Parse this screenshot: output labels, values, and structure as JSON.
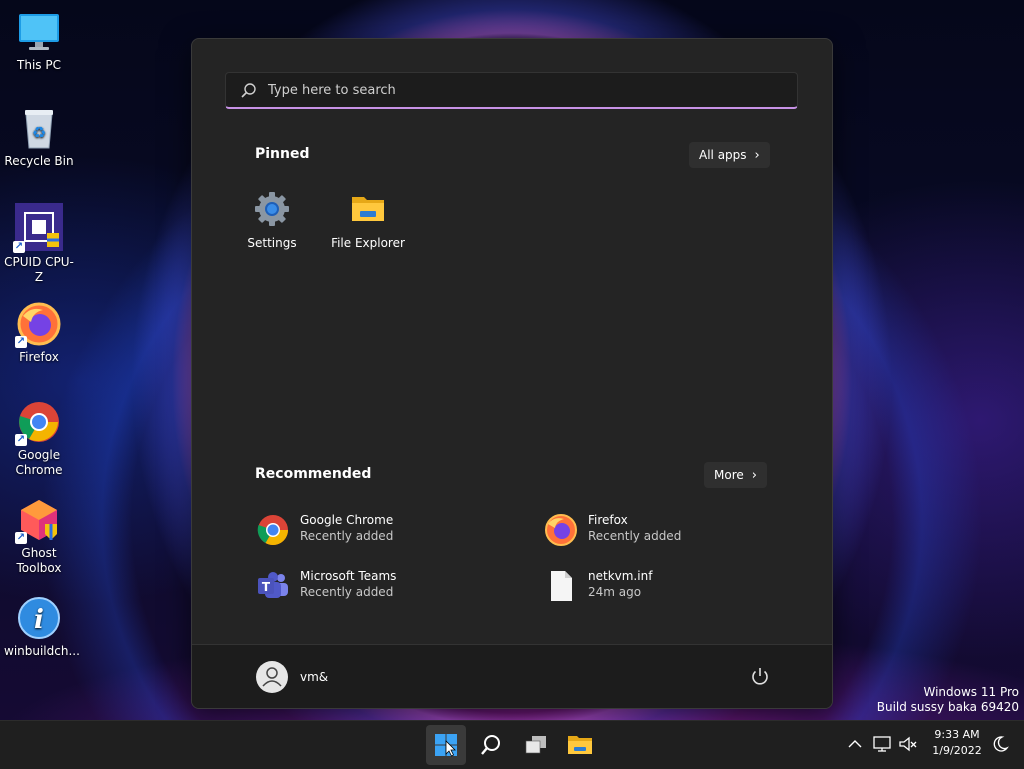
{
  "desktop": {
    "icons": [
      {
        "label": "This PC",
        "icon": "monitor-icon"
      },
      {
        "label": "Recycle Bin",
        "icon": "recycle-bin-icon"
      },
      {
        "label": "CPUID CPU-Z",
        "icon": "cpuz-icon"
      },
      {
        "label": "Firefox",
        "icon": "firefox-icon"
      },
      {
        "label": "Google\nChrome",
        "icon": "chrome-icon"
      },
      {
        "label": "Ghost\nToolbox",
        "icon": "ghost-toolbox-icon"
      },
      {
        "label": "winbuildch...",
        "icon": "info-icon"
      }
    ],
    "watermark": {
      "line1": "Windows 11 Pro",
      "line2": "Build sussy baka 69420"
    }
  },
  "start_menu": {
    "search_placeholder": "Type here to search",
    "pinned": {
      "title": "Pinned",
      "all_apps_label": "All apps",
      "items": [
        {
          "label": "Settings",
          "icon": "settings-gear-icon"
        },
        {
          "label": "File Explorer",
          "icon": "folder-icon"
        }
      ]
    },
    "recommended": {
      "title": "Recommended",
      "more_label": "More",
      "items": [
        {
          "name": "Google Chrome",
          "detail": "Recently added",
          "icon": "chrome-icon"
        },
        {
          "name": "Firefox",
          "detail": "Recently added",
          "icon": "firefox-icon"
        },
        {
          "name": "Microsoft Teams",
          "detail": "Recently added",
          "icon": "teams-icon"
        },
        {
          "name": "netkvm.inf",
          "detail": "24m ago",
          "icon": "file-icon"
        }
      ]
    },
    "user": {
      "name": "vm&"
    }
  },
  "taskbar": {
    "clock_time": "9:33 AM",
    "clock_date": "1/9/2022"
  },
  "colors": {
    "accent": "#c792e6",
    "menu_bg": "#242424",
    "taskbar_bg": "#1f1f1f"
  }
}
